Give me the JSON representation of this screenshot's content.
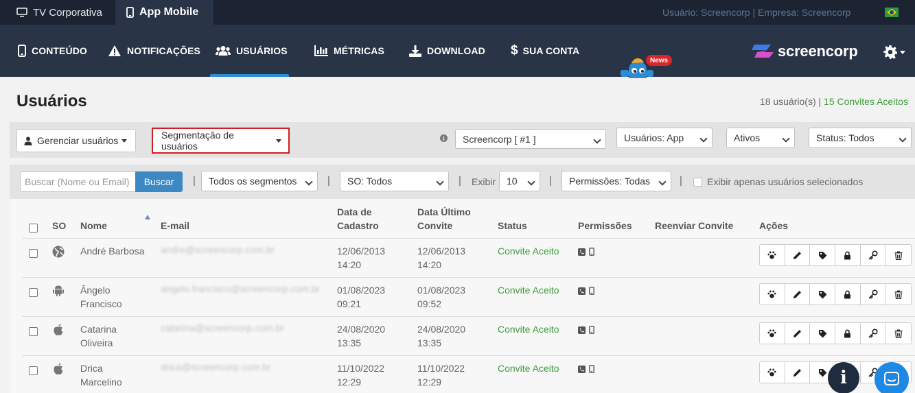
{
  "topbar": {
    "tabs": [
      {
        "label": "TV Corporativa",
        "icon": "monitor-icon"
      },
      {
        "label": "App Mobile",
        "icon": "mobile-icon",
        "active": true
      }
    ],
    "user_info": "Usuário: Screencorp | Empresa: Screencorp",
    "language_flag": "brazil-flag-icon"
  },
  "nav": {
    "items": [
      {
        "label": "CONTEÚDO",
        "icon": "mobile-icon"
      },
      {
        "label": "NOTIFICAÇÕES",
        "icon": "warning-icon"
      },
      {
        "label": "USUÁRIOS",
        "icon": "users-icon",
        "active": true
      },
      {
        "label": "MÉTRICAS",
        "icon": "bar-chart-icon"
      },
      {
        "label": "DOWNLOAD",
        "icon": "download-icon"
      },
      {
        "label": "SUA CONTA",
        "icon": "dollar-icon"
      }
    ],
    "news_badge": "News",
    "brand": "screencorp",
    "colors": {
      "topbar": "#1c2433",
      "nav": "#2a3447",
      "active_underline": "#2d8cd6",
      "badge": "#d8262b"
    }
  },
  "page": {
    "title": "Usuários",
    "user_count": "18 usuário(s)",
    "separator": "|",
    "invites_accepted": "15 Convites Aceitos"
  },
  "filters1": {
    "manage_users": "Gerenciar usuários",
    "segmentation": "Segmentação de usuários",
    "company": "Screencorp [ #1 ]",
    "users_type": "Usuários: App",
    "active_state": "Ativos",
    "status": "Status: Todos"
  },
  "filters2": {
    "search_placeholder": "Buscar (Nome ou Email)",
    "search_button": "Buscar",
    "segments": "Todos os segmentos",
    "os": "SO: Todos",
    "show_label": "Exibir",
    "page_size": "10",
    "permissions": "Permissões: Todas",
    "only_selected": "Exibir apenas usuários selecionados"
  },
  "table": {
    "headers": {
      "os": "SO",
      "name": "Nome",
      "email": "E-mail",
      "created_1": "Data de",
      "created_2": "Cadastro",
      "invite_1": "Data Último",
      "invite_2": "Convite",
      "status": "Status",
      "permissions": "Permissões",
      "resend": "Reenviar Convite",
      "actions": "Ações"
    },
    "rows": [
      {
        "os": "globe-icon",
        "name_1": "André Barbosa",
        "name_2": "",
        "email": "andre@screencorp.com.br",
        "created_date": "12/06/2013",
        "created_time": "14:20",
        "invite_date": "12/06/2013",
        "invite_time": "14:20",
        "status": "Convite Aceito"
      },
      {
        "os": "android-icon",
        "name_1": "Ângelo",
        "name_2": "Francisco",
        "email": "angelo.francisco@screencorp.com.br",
        "created_date": "01/08/2023",
        "created_time": "09:21",
        "invite_date": "01/08/2023",
        "invite_time": "09:52",
        "status": "Convite Aceito"
      },
      {
        "os": "apple-icon",
        "name_1": "Catarina",
        "name_2": "Oliveira",
        "email": "catarina@screencorp.com.br",
        "created_date": "24/08/2020",
        "created_time": "13:35",
        "invite_date": "24/08/2020",
        "invite_time": "13:35",
        "status": "Convite Aceito"
      },
      {
        "os": "apple-icon",
        "name_1": "Drica",
        "name_2": "Marcelino",
        "email": "drica@screencorp.com.br",
        "created_date": "11/10/2022",
        "created_time": "12:29",
        "invite_date": "11/10/2022",
        "invite_time": "12:29",
        "status": "Convite Aceito"
      }
    ]
  }
}
